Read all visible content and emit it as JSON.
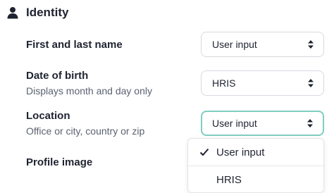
{
  "section": {
    "title": "Identity",
    "icon": "person-icon"
  },
  "fields": [
    {
      "label": "First and last name",
      "sublabel": "",
      "value": "User input"
    },
    {
      "label": "Date of birth",
      "sublabel": "Displays month and day only",
      "value": "HRIS"
    },
    {
      "label": "Location",
      "sublabel": "Office or city, country or zip",
      "value": "User input"
    },
    {
      "label": "Profile image",
      "sublabel": "",
      "value": ""
    }
  ],
  "dropdown": {
    "options": [
      {
        "label": "User input",
        "selected": true
      },
      {
        "label": "HRIS",
        "selected": false
      }
    ]
  },
  "colors": {
    "focus_border": "#7fcdc0",
    "text": "#1f2330",
    "muted": "#5a6170"
  }
}
